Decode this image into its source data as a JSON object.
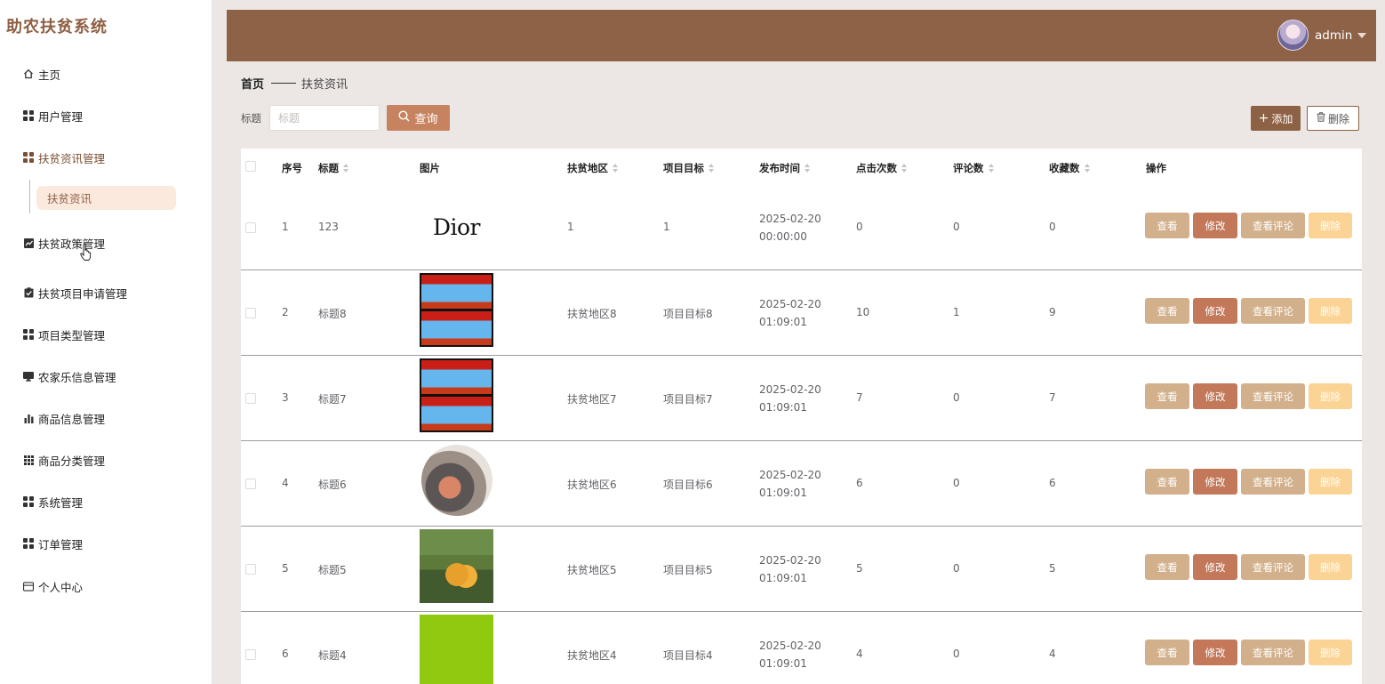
{
  "app": {
    "title": "助农扶贫系统"
  },
  "sidebar": {
    "items": [
      {
        "label": "主页",
        "icon": "home-icon"
      },
      {
        "label": "用户管理",
        "icon": "grid-icon"
      },
      {
        "label": "扶贫资讯管理",
        "icon": "grid-icon"
      },
      {
        "label": "扶贫政策管理",
        "icon": "trend-icon"
      },
      {
        "label": "扶贫项目申请管理",
        "icon": "clipboard-check-icon"
      },
      {
        "label": "项目类型管理",
        "icon": "grid-icon"
      },
      {
        "label": "农家乐信息管理",
        "icon": "monitor-icon"
      },
      {
        "label": "商品信息管理",
        "icon": "bar-chart-icon"
      },
      {
        "label": "商品分类管理",
        "icon": "grid9-icon"
      },
      {
        "label": "系统管理",
        "icon": "grid-icon"
      },
      {
        "label": "订单管理",
        "icon": "grid-icon"
      },
      {
        "label": "个人中心",
        "icon": "card-icon"
      }
    ],
    "active_sub": "扶贫资讯"
  },
  "header": {
    "username": "admin"
  },
  "breadcrumb": {
    "home": "首页",
    "current": "扶贫资讯"
  },
  "search": {
    "label": "标题",
    "placeholder": "标题",
    "value": "",
    "button": "查询"
  },
  "toolbar": {
    "add": "添加",
    "delete": "删除"
  },
  "table": {
    "columns": [
      "序号",
      "标题",
      "图片",
      "扶贫地区",
      "项目目标",
      "发布时间",
      "点击次数",
      "评论数",
      "收藏数",
      "操作"
    ],
    "actions": {
      "view": "查看",
      "edit": "修改",
      "comments": "查看评论",
      "delete": "删除"
    },
    "rows": [
      {
        "no": "1",
        "title": "123",
        "image": "Dior",
        "region": "1",
        "goal": "1",
        "time": "2025-02-20 00:00:00",
        "clicks": "0",
        "comments": "0",
        "favorites": "0"
      },
      {
        "no": "2",
        "title": "标题8",
        "image": "poster",
        "region": "扶贫地区8",
        "goal": "项目目标8",
        "time": "2025-02-20 01:09:01",
        "clicks": "10",
        "comments": "1",
        "favorites": "9"
      },
      {
        "no": "3",
        "title": "标题7",
        "image": "poster",
        "region": "扶贫地区7",
        "goal": "项目目标7",
        "time": "2025-02-20 01:09:01",
        "clicks": "7",
        "comments": "0",
        "favorites": "7"
      },
      {
        "no": "4",
        "title": "标题6",
        "image": "circle-photo",
        "region": "扶贫地区6",
        "goal": "项目目标6",
        "time": "2025-02-20 01:09:01",
        "clicks": "6",
        "comments": "0",
        "favorites": "6"
      },
      {
        "no": "5",
        "title": "标题5",
        "image": "farmer-photo",
        "region": "扶贫地区5",
        "goal": "项目目标5",
        "time": "2025-02-20 01:09:01",
        "clicks": "5",
        "comments": "0",
        "favorites": "5"
      },
      {
        "no": "6",
        "title": "标题4",
        "image": "green-logo",
        "region": "扶贫地区4",
        "goal": "项目目标4",
        "time": "2025-02-20 01:09:01",
        "clicks": "4",
        "comments": "0",
        "favorites": "4"
      }
    ]
  },
  "colors": {
    "primary": "#8e6247",
    "accent": "#c7835f",
    "view": "#d2b08c",
    "edit": "#c4785a",
    "delete": "#fbd394"
  }
}
